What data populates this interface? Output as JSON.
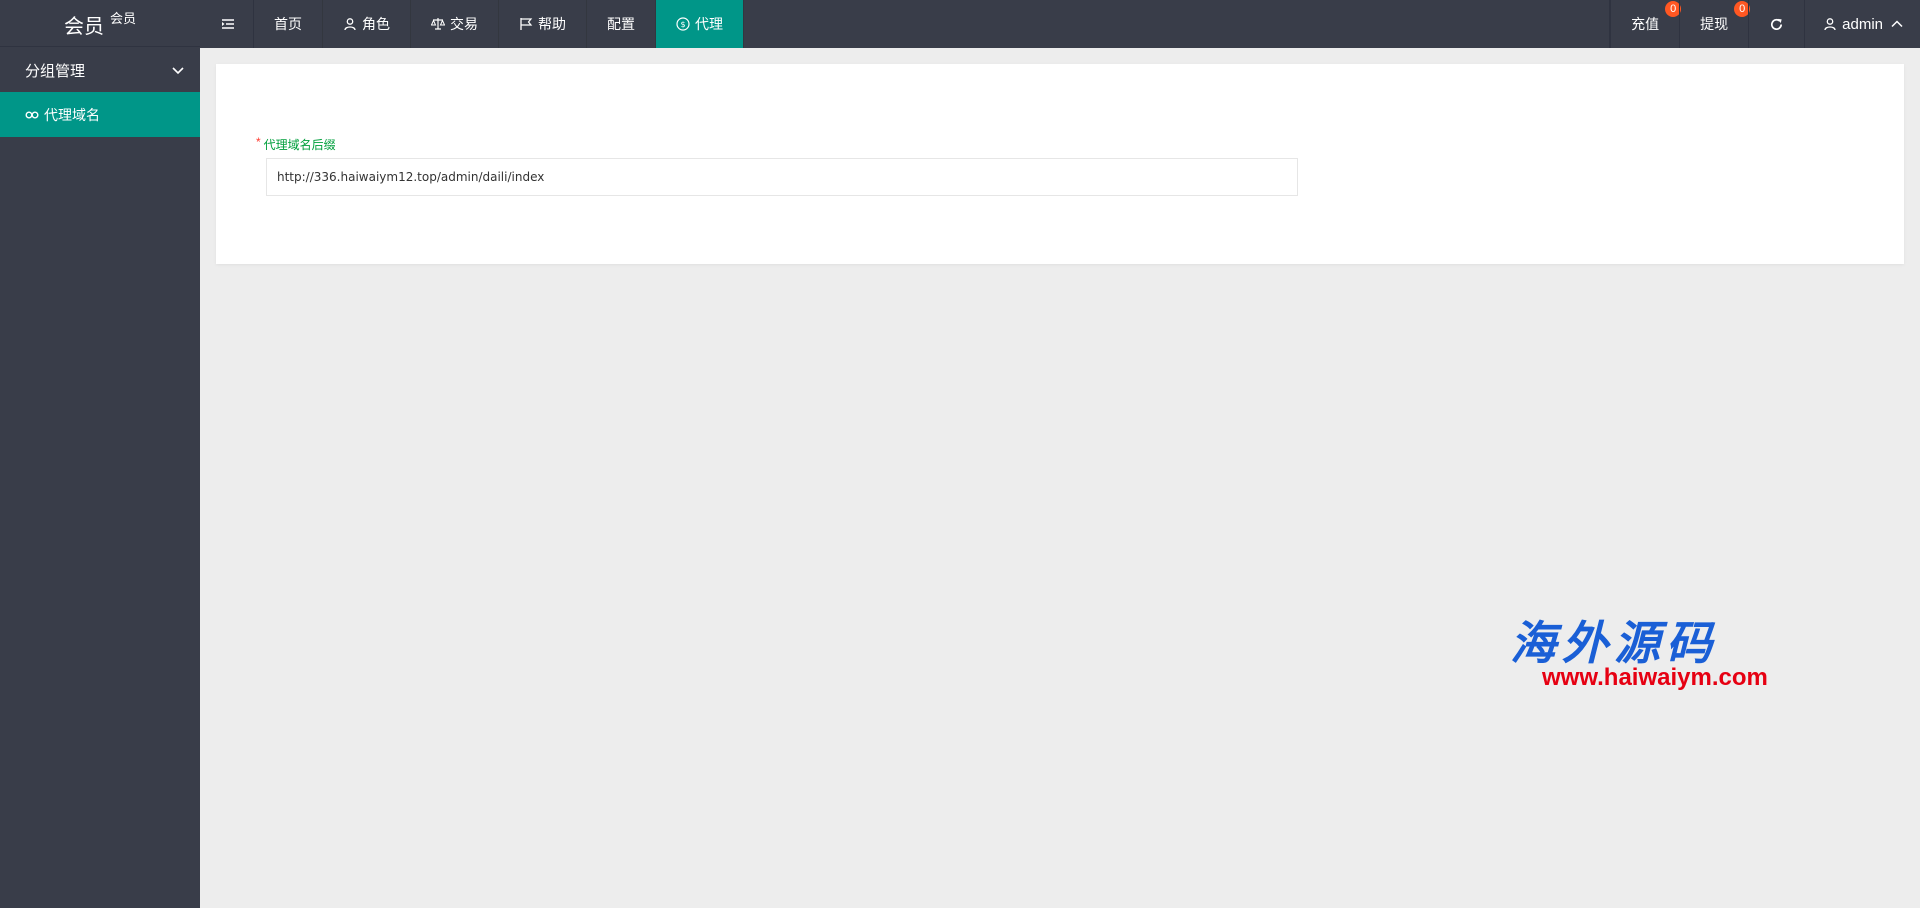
{
  "brand": {
    "title": "会员",
    "sub": "会员"
  },
  "sidebar": {
    "group_label": "分组管理",
    "items": [
      {
        "label": "代理域名",
        "active": true
      }
    ]
  },
  "topnav": {
    "items": [
      {
        "label": "首页",
        "icon": "none"
      },
      {
        "label": "角色",
        "icon": "user-icon"
      },
      {
        "label": "交易",
        "icon": "scale-icon"
      },
      {
        "label": "帮助",
        "icon": "flag-icon"
      },
      {
        "label": "配置",
        "icon": "none"
      },
      {
        "label": "代理",
        "icon": "dollar-icon",
        "active": true
      }
    ],
    "recharge": {
      "label": "充值",
      "count": "0"
    },
    "withdraw": {
      "label": "提现",
      "count": "0"
    },
    "user": "admin"
  },
  "form": {
    "label": "代理域名后缀",
    "required_mark": "*",
    "value": "http://336.haiwaiym12.top/admin/daili/index"
  },
  "watermark": {
    "cn": "海外源码",
    "url": "www.haiwaiym.com"
  },
  "colors": {
    "accent": "#009688",
    "nav_bg": "#393d49",
    "badge": "#ff5722",
    "label": "#009f3c"
  }
}
